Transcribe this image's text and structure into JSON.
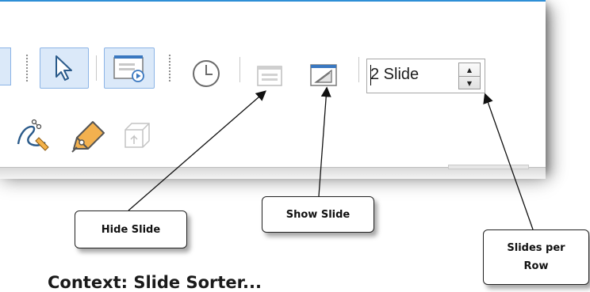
{
  "toolbar": {
    "slides_per_row_value": "2 Slide",
    "spin_up": "▲",
    "spin_down": "▼"
  },
  "icons": {
    "select": "pointer-arrow-icon",
    "slide_show": "slide-show-icon",
    "rehearse_timings": "clock-icon",
    "hide_slide": "hide-slide-icon",
    "show_slide": "show-slide-icon",
    "curve": "bezier-curve-icon",
    "edit_points": "pen-edit-icon",
    "shapes_3d": "3d-box-icon"
  },
  "callouts": {
    "hide_slide": "Hide Slide",
    "show_slide": "Show Slide",
    "slides_per_row": "Slides per Row"
  },
  "caption": {
    "partial_heading": "Context: Slide Sorter..."
  },
  "colors": {
    "accent_blue": "#2e8fd6",
    "active_button_bg": "#dbe9f9"
  }
}
